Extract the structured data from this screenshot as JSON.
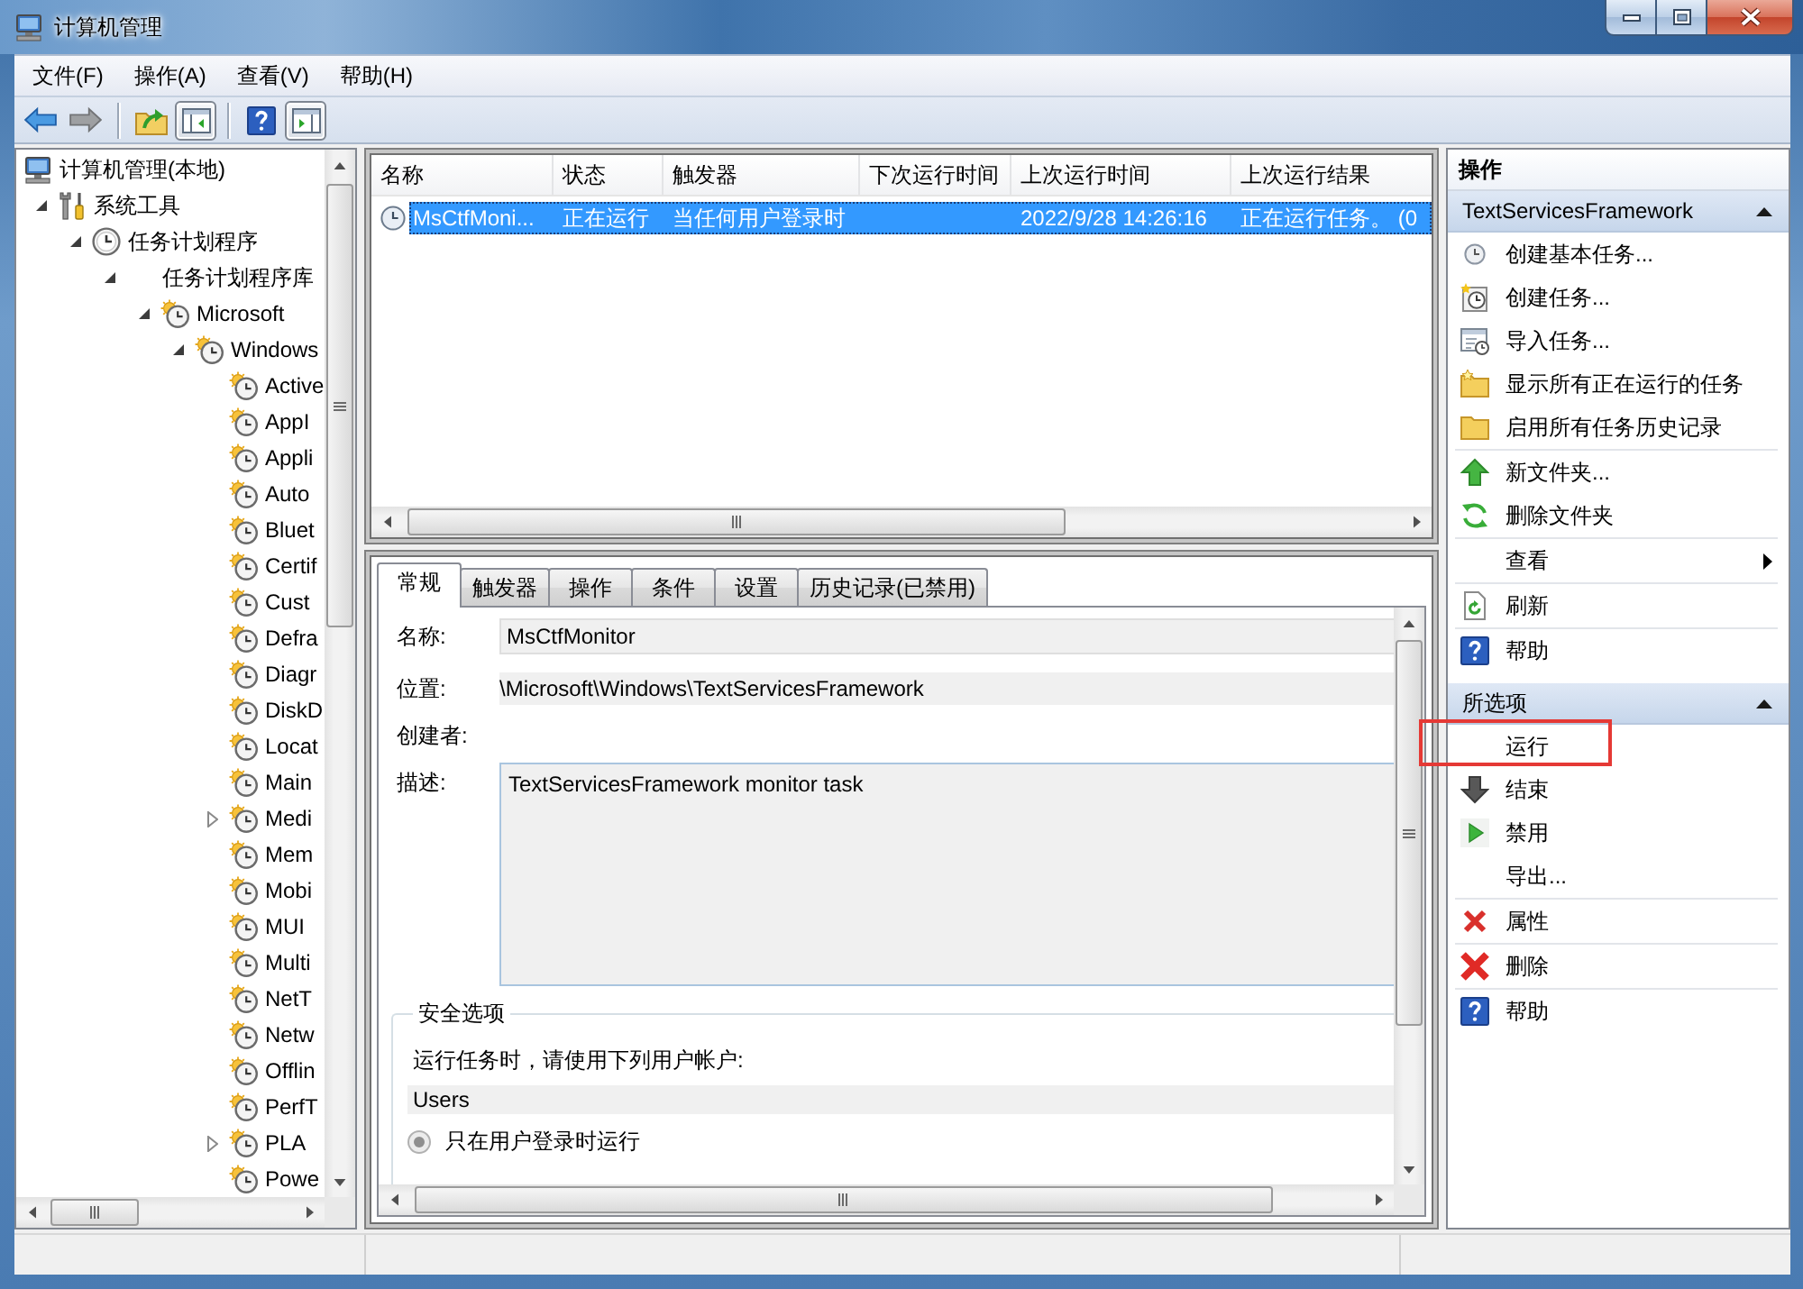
{
  "window": {
    "title": "计算机管理"
  },
  "menu": [
    "文件(F)",
    "操作(A)",
    "查看(V)",
    "帮助(H)"
  ],
  "toolbar": [
    [
      {
        "kind": "back",
        "disabled": false,
        "pressed": false
      },
      {
        "kind": "forward",
        "disabled": true,
        "pressed": false
      }
    ],
    [
      {
        "kind": "up",
        "disabled": false,
        "pressed": false
      },
      {
        "kind": "console-tree",
        "disabled": false,
        "pressed": true
      }
    ],
    [
      {
        "kind": "help",
        "disabled": false,
        "pressed": false
      },
      {
        "kind": "action-pane",
        "disabled": false,
        "pressed": true
      }
    ]
  ],
  "tree": {
    "items": [
      {
        "label": "计算机管理(本地)",
        "kind": "computer",
        "expandable": false,
        "children": [
          {
            "label": "系统工具",
            "kind": "tools",
            "expandable": true,
            "expanded": true,
            "children": [
              {
                "label": "任务计划程序",
                "kind": "scheduler",
                "expandable": true,
                "expanded": true,
                "children": [
                  {
                    "label": "任务计划程序库",
                    "expandable": true,
                    "expanded": true,
                    "children": [
                      {
                        "label": "Microsoft",
                        "kind": "task-folder",
                        "expandable": true,
                        "expanded": true,
                        "children": [
                          {
                            "label": "Windows",
                            "kind": "task-folder",
                            "expandable": true,
                            "expanded": true,
                            "children": [
                              {
                                "label": "Active",
                                "kind": "task-folder",
                                "expandable": false
                              },
                              {
                                "label": "AppI",
                                "kind": "task-folder",
                                "expandable": false
                              },
                              {
                                "label": "Appli",
                                "kind": "task-folder",
                                "expandable": false
                              },
                              {
                                "label": "Auto",
                                "kind": "task-folder",
                                "expandable": false
                              },
                              {
                                "label": "Bluet",
                                "kind": "task-folder",
                                "expandable": false
                              },
                              {
                                "label": "Certif",
                                "kind": "task-folder",
                                "expandable": false
                              },
                              {
                                "label": "Cust",
                                "kind": "task-folder",
                                "expandable": false
                              },
                              {
                                "label": "Defra",
                                "kind": "task-folder",
                                "expandable": false
                              },
                              {
                                "label": "Diagr",
                                "kind": "task-folder",
                                "expandable": false
                              },
                              {
                                "label": "DiskD",
                                "kind": "task-folder",
                                "expandable": false
                              },
                              {
                                "label": "Locat",
                                "kind": "task-folder",
                                "expandable": false
                              },
                              {
                                "label": "Main",
                                "kind": "task-folder",
                                "expandable": false
                              },
                              {
                                "label": "Medi",
                                "kind": "task-folder",
                                "expandable": true,
                                "expanded": false
                              },
                              {
                                "label": "Mem",
                                "kind": "task-folder",
                                "expandable": false
                              },
                              {
                                "label": "Mobi",
                                "kind": "task-folder",
                                "expandable": false
                              },
                              {
                                "label": "MUI",
                                "kind": "task-folder",
                                "expandable": false
                              },
                              {
                                "label": "Multi",
                                "kind": "task-folder",
                                "expandable": false
                              },
                              {
                                "label": "NetT",
                                "kind": "task-folder",
                                "expandable": false
                              },
                              {
                                "label": "Netw",
                                "kind": "task-folder",
                                "expandable": false
                              },
                              {
                                "label": "Offlin",
                                "kind": "task-folder",
                                "expandable": false
                              },
                              {
                                "label": "PerfT",
                                "kind": "task-folder",
                                "expandable": false
                              },
                              {
                                "label": "PLA",
                                "kind": "task-folder",
                                "expandable": true,
                                "expanded": false
                              },
                              {
                                "label": "Powe",
                                "kind": "task-folder",
                                "expandable": false
                              }
                            ]
                          }
                        ]
                      }
                    ]
                  }
                ]
              }
            ]
          }
        ]
      }
    ]
  },
  "task_list": {
    "columns": [
      "名称",
      "状态",
      "触发器",
      "下次运行时间",
      "上次运行时间",
      "上次运行结果"
    ],
    "rows": [
      {
        "name": "MsCtfMoni...",
        "status": "正在运行",
        "trigger": "当任何用户登录时",
        "last_run_time": "2022/9/28 14:26:16",
        "last_run_result": "正在运行任务。 (0",
        "selected": true
      }
    ]
  },
  "details": {
    "tabs": [
      {
        "label": "常规",
        "selected": true
      },
      {
        "label": "触发器",
        "selected": false
      },
      {
        "label": "操作",
        "selected": false
      },
      {
        "label": "条件",
        "selected": false
      },
      {
        "label": "设置",
        "selected": false
      },
      {
        "label": "历史记录(已禁用)",
        "selected": false
      }
    ],
    "fields": [
      {
        "label": "名称:",
        "value": "MsCtfMonitor",
        "kind": "box"
      },
      {
        "label": "位置:",
        "value": "\\Microsoft\\Windows\\TextServicesFramework",
        "kind": "band"
      },
      {
        "label": "创建者:",
        "kind": "plain"
      },
      {
        "label": "描述:",
        "value": "TextServicesFramework monitor task",
        "kind": "textarea"
      }
    ],
    "security": {
      "title": "安全选项",
      "prompt": "运行任务时，请使用下列用户帐户:",
      "account": "Users",
      "options": [
        {
          "label": "只在用户登录时运行",
          "selected": true,
          "disabled": true
        }
      ]
    }
  },
  "actions": {
    "title": "操作",
    "sections": [
      {
        "title": "TextServicesFramework",
        "expanded": true,
        "groups": [
          [
            {
              "label": "创建基本任务...",
              "kind": "basic-task",
              "highlighted": false
            },
            {
              "label": "创建任务...",
              "kind": "new-task",
              "highlighted": false
            },
            {
              "label": "导入任务...",
              "kind": "import",
              "highlighted": false
            },
            {
              "label": "显示所有正在运行的任务",
              "kind": "running",
              "highlighted": false
            },
            {
              "label": "启用所有任务历史记录",
              "kind": "history",
              "highlighted": false
            }
          ],
          [
            {
              "label": "新文件夹...",
              "kind": "new-folder",
              "highlighted": false
            },
            {
              "label": "删除文件夹",
              "kind": "delete-folder",
              "highlighted": false
            }
          ],
          [
            {
              "label": "查看",
              "kind": "view",
              "highlighted": false
            }
          ],
          [
            {
              "label": "刷新",
              "kind": "refresh",
              "highlighted": false
            }
          ],
          [
            {
              "label": "帮助",
              "kind": "help",
              "highlighted": false
            }
          ]
        ]
      },
      {
        "title": "所选项",
        "expanded": true,
        "groups": [
          [
            {
              "label": "运行",
              "kind": "run",
              "highlighted": true
            },
            {
              "label": "结束",
              "kind": "end",
              "highlighted": false
            },
            {
              "label": "禁用",
              "kind": "disable",
              "highlighted": false
            },
            {
              "label": "导出...",
              "kind": "export",
              "highlighted": false
            }
          ],
          [
            {
              "label": "属性",
              "kind": "properties",
              "highlighted": false
            }
          ],
          [
            {
              "label": "删除",
              "kind": "delete",
              "highlighted": false
            }
          ],
          [
            {
              "label": "帮助",
              "kind": "help",
              "highlighted": false
            }
          ]
        ]
      }
    ]
  }
}
